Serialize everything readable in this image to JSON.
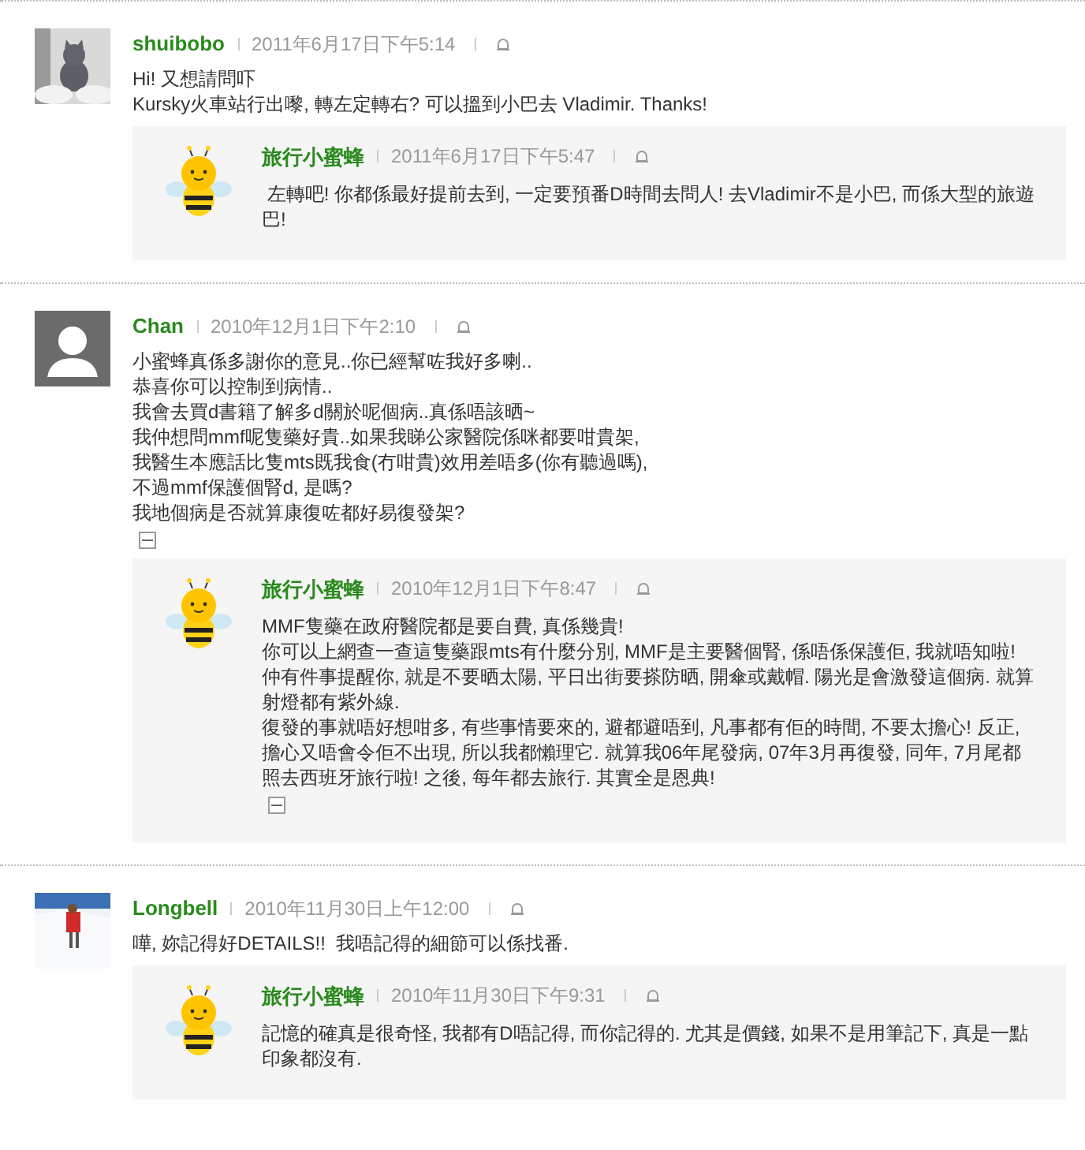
{
  "comments": [
    {
      "author": "shuibobo",
      "date": "2011年6月17日下午5:14",
      "avatar": {
        "kind": "cat_photo"
      },
      "lines": [
        "Hi! 又想請問吓",
        "Kursky火車站行出嚟, 轉左定轉右? 可以搵到小巴去 Vladimir. Thanks!"
      ],
      "collapse_toggle": false,
      "reply": {
        "author": "旅行小蜜蜂",
        "date": "2011年6月17日下午5:47",
        "paragraphs": [
          " 左轉吧! 你都係最好提前去到, 一定要預番D時間去問人! 去Vladimir不是小巴, 而係大型的旅遊巴!"
        ],
        "collapse_toggle": false
      }
    },
    {
      "author": "Chan",
      "date": "2010年12月1日下午2:10",
      "avatar": {
        "kind": "default"
      },
      "lines": [
        "小蜜蜂真係多謝你的意見..你已經幫咗我好多喇..",
        "恭喜你可以控制到病情..",
        "我會去買d書籍了解多d關於呢個病..真係唔該晒~",
        "我仲想問mmf呢隻藥好貴..如果我睇公家醫院係咪都要咁貴架,",
        "我醫生本應話比隻mts既我食(冇咁貴)效用差唔多(你有聽過嗎),",
        "不過mmf保護個腎d, 是嗎?",
        "我地個病是否就算康復咗都好易復發架?"
      ],
      "collapse_toggle": true,
      "reply": {
        "author": "旅行小蜜蜂",
        "date": "2010年12月1日下午8:47",
        "paragraphs": [
          "MMF隻藥在政府醫院都是要自費, 真係幾貴!",
          "你可以上網查一查這隻藥跟mts有什麼分別, MMF是主要醫個腎, 係唔係保護佢, 我就唔知啦!",
          "仲有件事提醒你, 就是不要晒太陽, 平日出街要搽防晒, 開傘或戴帽. 陽光是會激發這個病. 就算射燈都有紫外線.",
          "復發的事就唔好想咁多, 有些事情要來的, 避都避唔到, 凡事都有佢的時間, 不要太擔心! 反正, 擔心又唔會令佢不出現, 所以我都懶理它. 就算我06年尾發病, 07年3月再復發, 同年, 7月尾都照去西班牙旅行啦! 之後, 每年都去旅行. 其實全是恩典!"
        ],
        "collapse_toggle": true
      }
    },
    {
      "author": "Longbell",
      "date": "2010年11月30日上午12:00",
      "avatar": {
        "kind": "snow_photo"
      },
      "lines": [
        "嘩, 妳記得好DETAILS!!  我唔記得的細節可以係找番."
      ],
      "collapse_toggle": false,
      "reply": {
        "author": "旅行小蜜蜂",
        "date": "2010年11月30日下午9:31",
        "paragraphs": [
          "記憶的確真是很奇怪, 我都有D唔記得, 而你記得的. 尤其是價錢, 如果不是用筆記下, 真是一點印象都沒有."
        ],
        "collapse_toggle": false
      }
    }
  ]
}
